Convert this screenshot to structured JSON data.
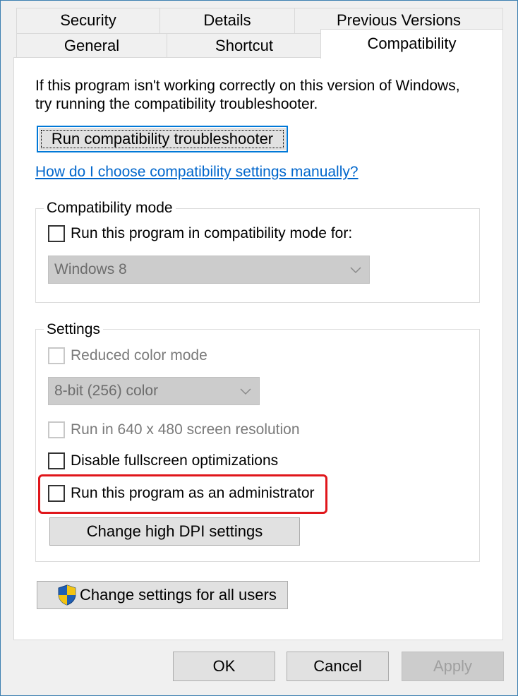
{
  "tabs": {
    "row1": [
      "Security",
      "Details",
      "Previous Versions"
    ],
    "row2": [
      "General",
      "Shortcut",
      "Compatibility"
    ],
    "active": "Compatibility"
  },
  "intro": {
    "line1": "If this program isn't working correctly on this version of Windows,",
    "line2": "try running the compatibility troubleshooter."
  },
  "troubleshooter_button": "Run compatibility troubleshooter",
  "help_link": "How do I choose compatibility settings manually?",
  "compat_mode": {
    "title": "Compatibility mode",
    "checkbox_label": "Run this program in compatibility mode for:",
    "checked": false,
    "os_select": "Windows 8"
  },
  "settings": {
    "title": "Settings",
    "reduced_color_label": "Reduced color mode",
    "reduced_color_select": "8-bit (256) color",
    "resolution_label": "Run in 640 x 480 screen resolution",
    "fullscreen_label": "Disable fullscreen optimizations",
    "admin_label": "Run this program as an administrator",
    "dpi_button": "Change high DPI settings"
  },
  "all_users_button": "Change settings for all users",
  "footer": {
    "ok": "OK",
    "cancel": "Cancel",
    "apply": "Apply"
  },
  "colors": {
    "highlight": "#e0161b",
    "link": "#0066cc",
    "focus": "#0078d7"
  },
  "icons": {
    "shield": "uac-shield-icon",
    "chevron": "chevron-down-icon"
  }
}
